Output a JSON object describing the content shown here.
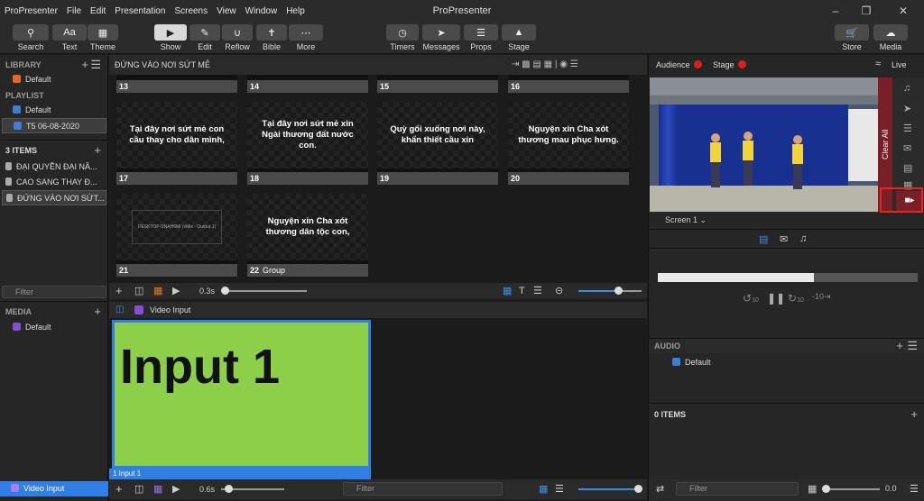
{
  "app": {
    "name": "ProPresenter",
    "title": "ProPresenter"
  },
  "menu": [
    "ProPresenter",
    "File",
    "Edit",
    "Presentation",
    "Screens",
    "View",
    "Window",
    "Help"
  ],
  "toolbar": {
    "search": "Search",
    "text": "Text",
    "theme": "Theme",
    "show": "Show",
    "edit": "Edit",
    "reflow": "Reflow",
    "bible": "Bible",
    "more": "More",
    "timers": "Timers",
    "messages": "Messages",
    "props": "Props",
    "stage": "Stage",
    "store": "Store",
    "media": "Media"
  },
  "library": {
    "header": "LIBRARY",
    "items": [
      "Default"
    ],
    "playlist_header": "PLAYLIST",
    "playlist": [
      "Default",
      "T5 06-08-2020"
    ]
  },
  "items_section": {
    "header": "3 ITEMS",
    "items": [
      "ĐẠI QUYỀN ĐẠI NĂ...",
      "CAO SANG THAY Đ...",
      "ĐỨNG VÀO NƠI SỨT..."
    ]
  },
  "filter_placeholder": "Filter",
  "media_section": {
    "header": "MEDIA",
    "items": [
      "Default"
    ],
    "selected": "Video Input"
  },
  "presentation": {
    "title": "ĐỨNG VÀO NƠI SỨT MẺ",
    "top_row": [
      "13",
      "14",
      "15",
      "16"
    ],
    "slides": [
      {
        "num": "17",
        "text": "Tại đây nơi sứt mẻ con cầu thay cho dân mình,"
      },
      {
        "num": "18",
        "text": "Tại đây nơi sứt mẻ xin Ngài thương đất nước con."
      },
      {
        "num": "19",
        "text": "Quỳ gối xuống nơi này, khẩn thiết cầu xin"
      },
      {
        "num": "20",
        "text": "Nguyện xin Cha xót thương mau phục hưng."
      },
      {
        "num": "21",
        "text": "DESKTOP-SNAH6MI (vMix - Output 1)"
      },
      {
        "num": "22",
        "group": "Group",
        "text": "Nguyện xin Cha xót thương dân tộc con,"
      }
    ],
    "transition_time": "0.3s"
  },
  "media_bin": {
    "title": "Video Input",
    "thumb_text": "Input 1",
    "thumb_caption": "1  Input 1",
    "transition_time": "0.6s"
  },
  "right": {
    "audience": "Audience",
    "stage": "Stage",
    "live": "Live",
    "clear_all": "Clear All",
    "screen": "Screen 1",
    "playback_progress": 0.6,
    "skip_back": "10",
    "skip_fwd": "10",
    "skip_back2": "-10",
    "audio_header": "AUDIO",
    "audio_items": [
      "Default"
    ],
    "items_header": "0 ITEMS",
    "volume": "0.0"
  },
  "colors": {
    "accent": "#2f7fe6",
    "clear_all": "#7a1f26",
    "live_dot": "#e41b1b",
    "input_bg": "#8ccf49"
  }
}
